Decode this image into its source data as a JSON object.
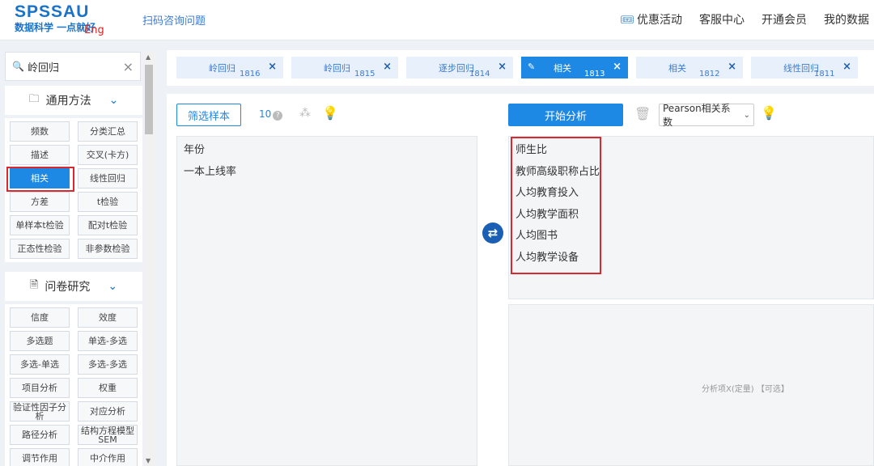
{
  "header": {
    "logo_main": "SPSSAU",
    "logo_sub": "数据科学 一点就好",
    "logo_eng": "Eng",
    "link": "扫码咨询问题",
    "nav": [
      "优惠活动",
      "客服中心",
      "开通会员",
      "我的数据"
    ]
  },
  "sidebar": {
    "search_value": "岭回归",
    "general": {
      "title": "通用方法",
      "items": [
        "频数",
        "分类汇总",
        "描述",
        "交叉(卡方)",
        "相关",
        "线性回归",
        "方差",
        "t检验",
        "单样本t检验",
        "配对t检验",
        "正态性检验",
        "非参数检验"
      ],
      "active_index": 4
    },
    "survey": {
      "title": "问卷研究",
      "items": [
        "信度",
        "效度",
        "多选题",
        "单选-多选",
        "多选-单选",
        "多选-多选",
        "项目分析",
        "权重",
        "验证性因子分析",
        "对应分析",
        "路径分析",
        "结构方程模型SEM",
        "调节作用",
        "中介作用"
      ]
    }
  },
  "tabs": [
    {
      "label": "岭回归",
      "num": "1816",
      "active": false
    },
    {
      "label": "岭回归",
      "num": "1815",
      "active": false
    },
    {
      "label": "逐步回归",
      "num": "1814",
      "active": false
    },
    {
      "label": "相关",
      "num": "1813",
      "active": true
    },
    {
      "label": "相关",
      "num": "1812",
      "active": false
    },
    {
      "label": "线性回归",
      "num": "1811",
      "active": false
    }
  ],
  "tab_close": "×",
  "main": {
    "filter_label": "筛选样本",
    "count": "10",
    "analyze_label": "开始分析",
    "method_select": "Pearson相关系数",
    "left_vars": [
      "年份",
      "一本上线率"
    ],
    "right_vars": [
      "师生比",
      "教师高级职称占比",
      "人均教育投入",
      "人均教学面积",
      "人均图书",
      "人均教学设备"
    ],
    "right2_placeholder": "分析项X(定量) 【可选】"
  }
}
